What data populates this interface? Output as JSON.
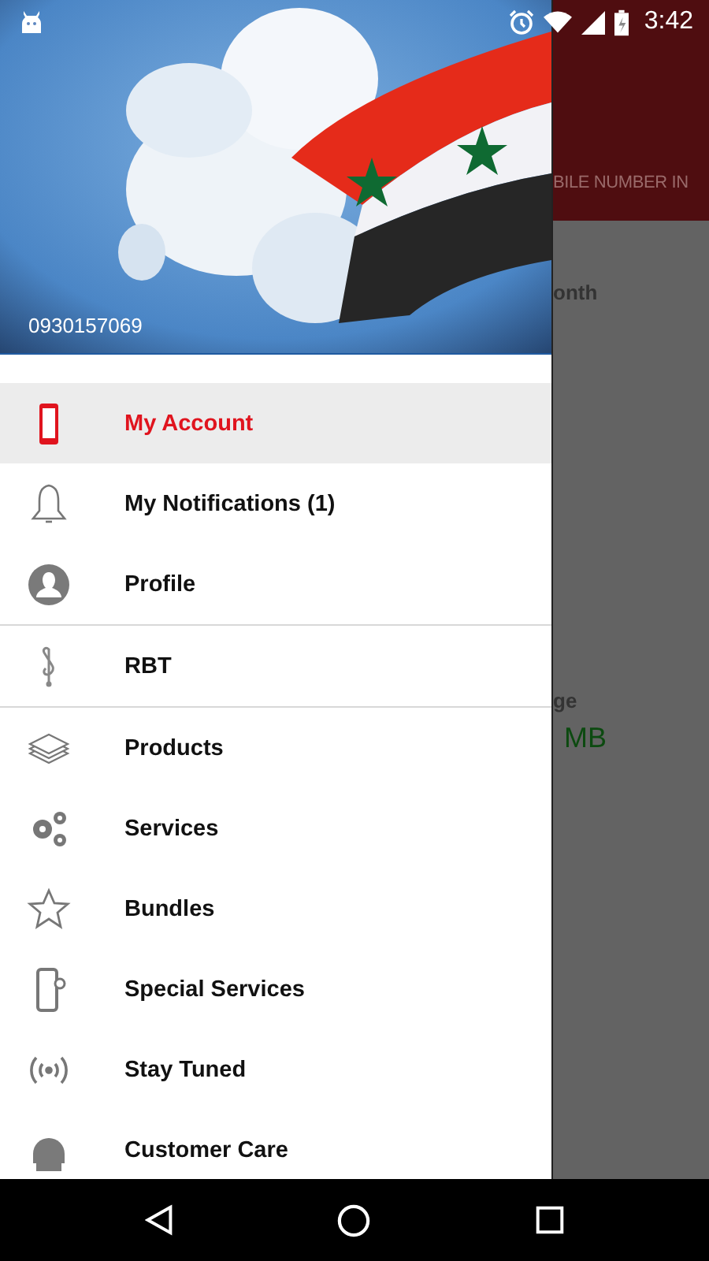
{
  "status_bar": {
    "time": "3:42"
  },
  "drawer": {
    "header": {
      "phone": "0930157069"
    },
    "items": [
      {
        "label": "My Account",
        "selected": true,
        "divider_after": false
      },
      {
        "label": "My Notifications (1)",
        "selected": false,
        "divider_after": false
      },
      {
        "label": "Profile",
        "selected": false,
        "divider_after": true
      },
      {
        "label": "RBT",
        "selected": false,
        "divider_after": true
      },
      {
        "label": "Products",
        "selected": false,
        "divider_after": false
      },
      {
        "label": "Services",
        "selected": false,
        "divider_after": false
      },
      {
        "label": "Bundles",
        "selected": false,
        "divider_after": false
      },
      {
        "label": "Special Services",
        "selected": false,
        "divider_after": false
      },
      {
        "label": "Stay Tuned",
        "selected": false,
        "divider_after": false
      },
      {
        "label": "Customer Care",
        "selected": false,
        "divider_after": false
      }
    ]
  },
  "background_page": {
    "tab_title": "BILE NUMBER IN",
    "label_1": "onth",
    "label_2": "ge",
    "value": "MB"
  }
}
